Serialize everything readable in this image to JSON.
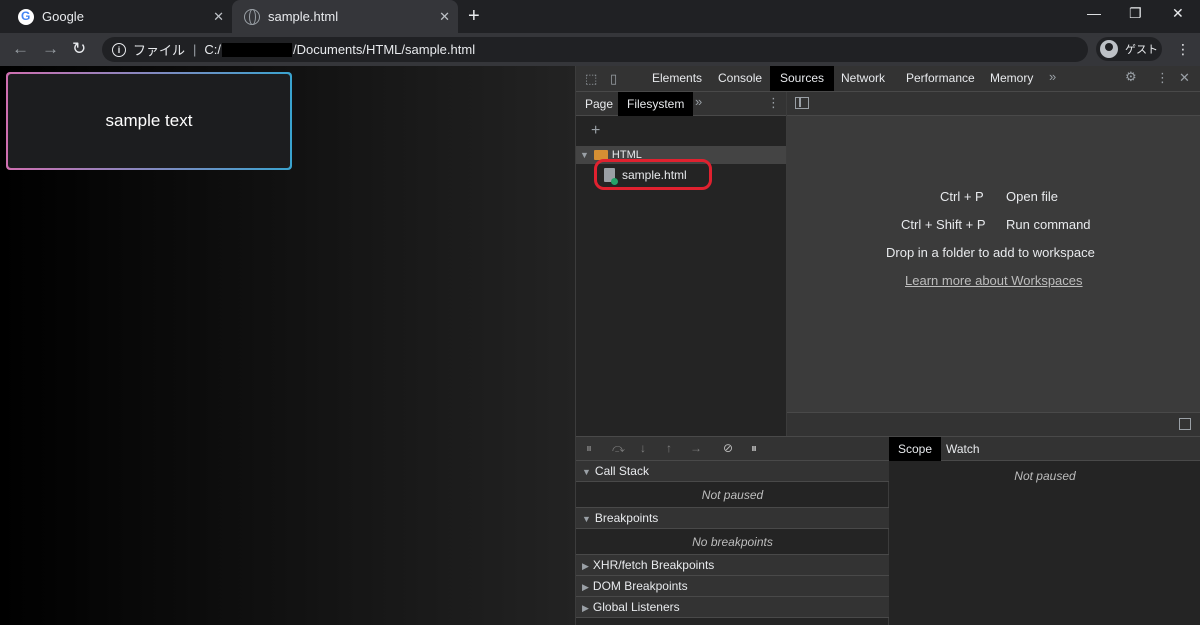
{
  "tabs": [
    {
      "title": "Google",
      "close": "✕"
    },
    {
      "title": "sample.html",
      "close": "✕"
    }
  ],
  "new_tab": "+",
  "window_controls": {
    "minimize": "—",
    "restore": "❐",
    "close": "✕"
  },
  "nav": {
    "back": "←",
    "forward": "→",
    "reload": "↻"
  },
  "omnibox": {
    "info": "i",
    "scheme": "ファイル",
    "separator": "|",
    "path_prefix": "C:/",
    "path_suffix": "/Documents/HTML/sample.html"
  },
  "profile": {
    "label": "ゲスト"
  },
  "menu": "⋮",
  "page": {
    "sample_text": "sample text"
  },
  "devtools": {
    "tabs": [
      "Elements",
      "Console",
      "Sources",
      "Network",
      "Performance",
      "Memory"
    ],
    "active_tab": "Sources",
    "more": "»",
    "settings": "⚙",
    "kebab": "⋮",
    "close": "✕",
    "navigator": {
      "tabs": [
        "Page",
        "Filesystem"
      ],
      "active_tab": "Filesystem",
      "more": "»",
      "kebab": "⋮",
      "add": "+",
      "folder": "HTML",
      "file": "sample.html"
    },
    "editor": {
      "shortcuts": [
        {
          "keys": "Ctrl + P",
          "action": "Open file"
        },
        {
          "keys": "Ctrl + Shift + P",
          "action": "Run command"
        }
      ],
      "drop_text": "Drop in a folder to add to workspace",
      "learn_link": "Learn more about Workspaces"
    },
    "debugger": {
      "icons": [
        "⏸",
        "⤼",
        "↓",
        "↑",
        "→",
        "⊘",
        "⏸"
      ],
      "call_stack": {
        "title": "Call Stack",
        "body": "Not paused"
      },
      "breakpoints": {
        "title": "Breakpoints",
        "body": "No breakpoints"
      },
      "sections": [
        "XHR/fetch Breakpoints",
        "DOM Breakpoints",
        "Global Listeners"
      ]
    },
    "scope": {
      "tabs": [
        "Scope",
        "Watch"
      ],
      "active_tab": "Scope",
      "body": "Not paused"
    }
  }
}
